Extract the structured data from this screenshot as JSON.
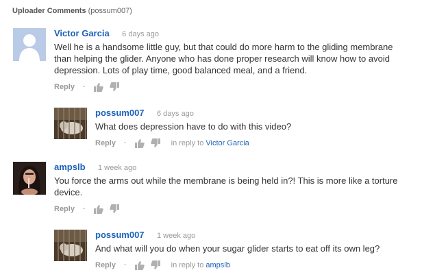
{
  "section": {
    "title": "Uploader Comments",
    "uploader": "(possum007)"
  },
  "colors": {
    "link": "#1c62b9",
    "meta": "#999999",
    "text": "#333333"
  },
  "comments": [
    {
      "author": "Victor Garcia",
      "time": "6 days ago",
      "text": "Well he is a handsome little guy, but that could do more harm to the gliding membrane than helping the glider. Anyone who has done proper research will know how to avoid depression. Lots of play time, good balanced meal, and a friend.",
      "reply_label": "Reply",
      "separator": "·",
      "avatar": "default-user-avatar"
    },
    {
      "author": "possum007",
      "time": "6 days ago",
      "text": "What does depression have to do with this video?",
      "reply_label": "Reply",
      "separator": "·",
      "in_reply_prefix": "in reply to",
      "in_reply_to": "Victor Garcia",
      "avatar": "caged-animal-photo"
    },
    {
      "author": "ampslb",
      "time": "1 week ago",
      "text": "You force the arms out while the membrane is being held in?! This is more like a torture device.",
      "reply_label": "Reply",
      "separator": "·",
      "avatar": "person-photo"
    },
    {
      "author": "possum007",
      "time": "1 week ago",
      "text": "And what will you do when your sugar glider starts to eat off its own leg?",
      "reply_label": "Reply",
      "separator": "·",
      "in_reply_prefix": "in reply to",
      "in_reply_to": "ampslb",
      "avatar": "caged-animal-photo"
    }
  ]
}
